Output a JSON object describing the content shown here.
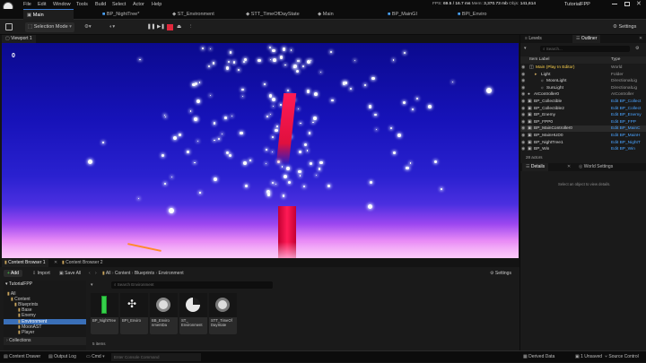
{
  "menu": {
    "items": [
      "File",
      "Edit",
      "Window",
      "Tools",
      "Build",
      "Select",
      "Actor",
      "Help"
    ]
  },
  "window_title": "TutorialFPP",
  "stats": {
    "fps_label": "FPS:",
    "fps": "69.5",
    "ms": "/ 16.7 ms",
    "mem_label": "Mem:",
    "mem": "3,370.73 mb",
    "objs_label": "Objs:",
    "objs": "141,614"
  },
  "doc_tabs": [
    "Main",
    "BP_NightTree*",
    "ST_Environment",
    "STT_TimeOfDayState",
    "Main",
    "BP_MainGI",
    "BPI_Enviro"
  ],
  "toolbar": {
    "mode": "Selection Mode",
    "settings": "Settings"
  },
  "viewport": {
    "tab": "Viewport 1",
    "counter": "0"
  },
  "panels": {
    "levels": "Levels",
    "outliner": "Outliner",
    "search_placeholder": "Search...",
    "col_label": "Item Label",
    "col_type": "Type",
    "actor_count": "28 actors",
    "details": "Details",
    "world_settings": "World Settings",
    "details_empty": "Select an object to view details."
  },
  "outliner": [
    {
      "name": "Main (Play In Editor)",
      "type": "World"
    },
    {
      "name": "Light",
      "type": "Folder"
    },
    {
      "name": "MoonLight",
      "type": "DirectionalLig"
    },
    {
      "name": "SunLight",
      "type": "DirectionalLig"
    },
    {
      "name": "AIController0",
      "type": "AIController"
    },
    {
      "name": "BP_Collectible",
      "type": "Edit BP_Collect"
    },
    {
      "name": "BP_Collectible2",
      "type": "Edit BP_Collect"
    },
    {
      "name": "BP_Enemy",
      "type": "Edit BP_Enemy"
    },
    {
      "name": "BP_FPP0",
      "type": "Edit BP_FPP"
    },
    {
      "name": "BP_MainController0",
      "type": "Edit BP_MainC"
    },
    {
      "name": "BP_MainHUD0",
      "type": "Edit BP_MainH"
    },
    {
      "name": "BP_NightTree1",
      "type": "Edit BP_NightT"
    },
    {
      "name": "BP_Win",
      "type": "Edit BP_Win"
    }
  ],
  "content_browser": {
    "tab1": "Content Browser 1",
    "tab2": "Content Browser 2",
    "add": "Add",
    "import": "Import",
    "save_all": "Save All",
    "path": [
      "All",
      "Content",
      "Blueprints",
      "Environment"
    ],
    "settings": "Settings",
    "search_placeholder": "Search Environment",
    "root": "TutorialFPP",
    "items_count": "5 items",
    "collections": "Collections"
  },
  "folders": [
    "All",
    "Content",
    "Blueprints",
    "Base",
    "Enemy",
    "Environment",
    "MoonAST",
    "Player"
  ],
  "assets": [
    {
      "label": "BP_NightTree",
      "accent": "#33d14a"
    },
    {
      "label": "BPI_Enviro"
    },
    {
      "label": "BB_Enviro nmentDa"
    },
    {
      "label": "ST_ Environment"
    },
    {
      "label": "STT_TimeOf DayState"
    }
  ],
  "status": {
    "drawer": "Content Drawer",
    "output": "Output Log",
    "cmd": "Cmd",
    "console_placeholder": "Enter Console Command",
    "derived": "Derived Data",
    "unsaved": "1 Unsaved",
    "source": "Source Control"
  }
}
